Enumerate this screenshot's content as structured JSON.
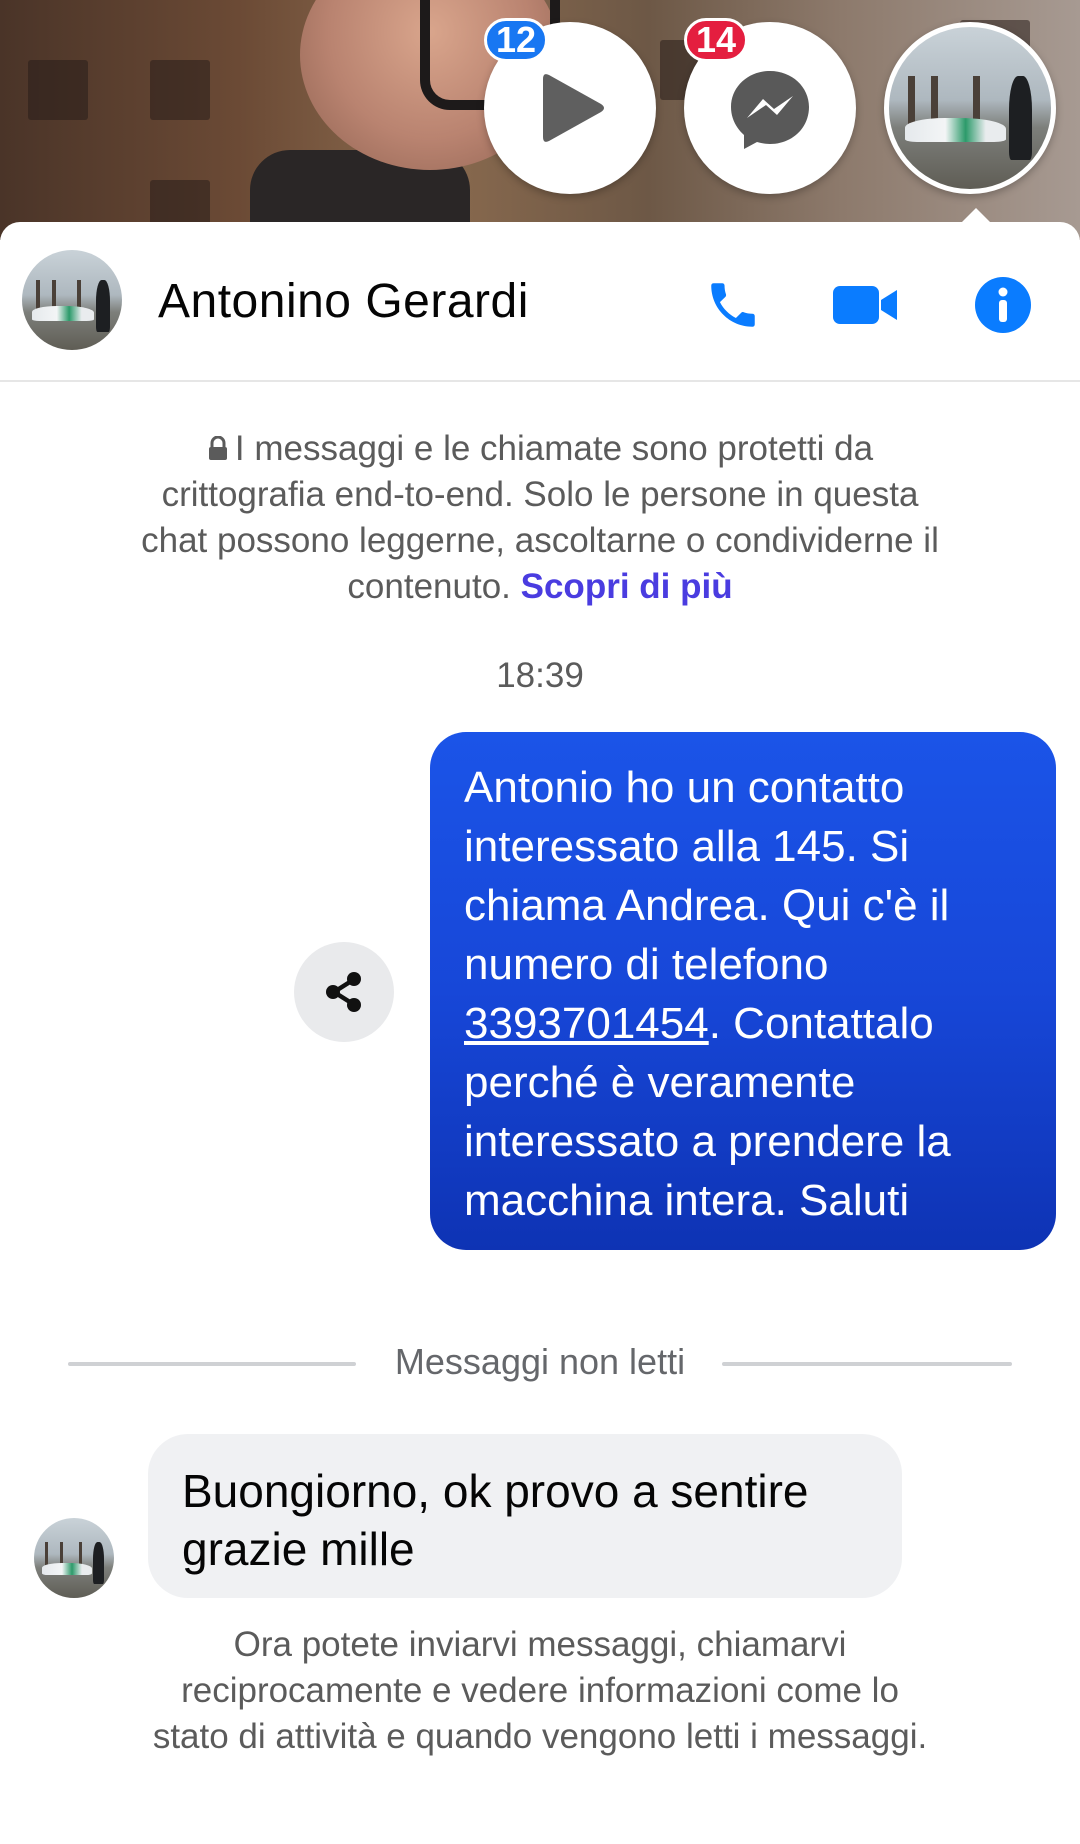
{
  "chat_heads": {
    "video": {
      "badge": "12",
      "icon": "play-icon",
      "badge_color": "#1877f2"
    },
    "messenger": {
      "badge": "14",
      "icon": "messenger-icon",
      "badge_color": "#e41e3f"
    },
    "contact": {
      "icon": "avatar"
    }
  },
  "header": {
    "contact_name": "Antonino Gerardi",
    "call_icon": "phone-icon",
    "video_icon": "video-camera-icon",
    "info_icon": "info-icon",
    "accent": "#0a7cff"
  },
  "encryption_notice": {
    "text": "I messaggi e le chiamate sono protetti da crittografia end-to-end. Solo le persone in questa chat possono leggerne, ascoltarne o condividerne il contenuto.",
    "link": "Scopri di più",
    "icon": "lock-icon"
  },
  "timestamp": "18:39",
  "outgoing_message": {
    "text_before": "Antonio ho un contatto interessato alla 145. Si chiama Andrea. Qui c'è il numero di telefono ",
    "phone": "3393701454",
    "text_after": ". Contattalo perché è veramente interessato a prendere la macchina intera. Saluti",
    "share_icon": "share-icon"
  },
  "unread_divider": "Messaggi non letti",
  "incoming_message": {
    "text": "Buongiorno, ok provo a sentire grazie mille"
  },
  "footer_note": "Ora potete inviarvi messaggi, chiamarvi reciprocamente e vedere informazioni come lo stato di attività e quando vengono letti i messaggi."
}
